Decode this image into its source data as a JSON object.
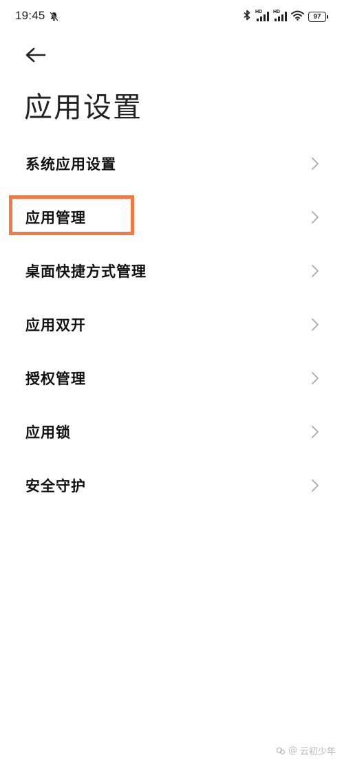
{
  "status_bar": {
    "time": "19:45",
    "network_1": "HD",
    "network_2": "HD",
    "battery": "97"
  },
  "header": {
    "title": "应用设置"
  },
  "menu": [
    {
      "label": "系统应用设置"
    },
    {
      "label": "应用管理"
    },
    {
      "label": "桌面快捷方式管理"
    },
    {
      "label": "应用双开"
    },
    {
      "label": "授权管理"
    },
    {
      "label": "应用锁"
    },
    {
      "label": "安全守护"
    }
  ],
  "watermark": {
    "text": "云初少年"
  },
  "colors": {
    "highlight": "#f07a45"
  }
}
